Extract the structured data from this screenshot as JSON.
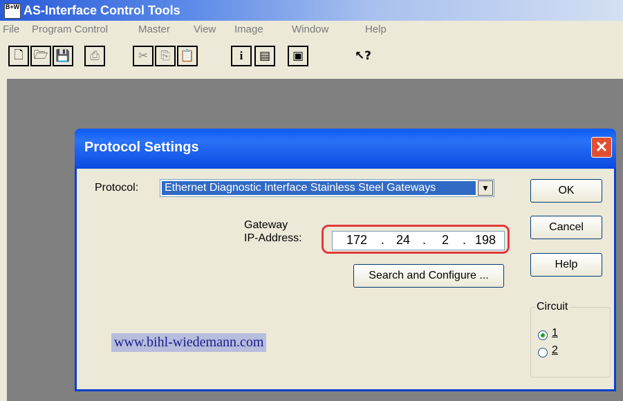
{
  "app": {
    "title": "AS-Interface Control Tools",
    "icon_text": "B+W"
  },
  "menu": [
    "File",
    "Program Control",
    "Master",
    "View",
    "Image",
    "Window",
    "Help"
  ],
  "toolbar": [
    {
      "icon": "new-document-icon",
      "glyph": "🗋",
      "disabled": false
    },
    {
      "icon": "open-folder-icon",
      "glyph": "🗁",
      "disabled": false
    },
    {
      "icon": "save-icon",
      "glyph": "💾",
      "disabled": true
    },
    {
      "icon": "print-icon",
      "glyph": "⎙",
      "disabled": true
    },
    {
      "icon": "cut-icon",
      "glyph": "✂",
      "disabled": true
    },
    {
      "icon": "copy-icon",
      "glyph": "⎘",
      "disabled": true
    },
    {
      "icon": "paste-icon",
      "glyph": "📋",
      "disabled": true
    },
    {
      "icon": "info-icon",
      "glyph": "i",
      "disabled": false
    },
    {
      "icon": "panel-icon",
      "glyph": "▤",
      "disabled": false
    },
    {
      "icon": "window-icon",
      "glyph": "▣",
      "disabled": false
    },
    {
      "icon": "context-help-icon",
      "glyph": "↖?",
      "disabled": false
    }
  ],
  "dialog": {
    "title": "Protocol Settings",
    "close_symbol": "✕",
    "protocol_label": "Protocol:",
    "protocol_value": "Ethernet Diagnostic Interface Stainless Steel Gateways",
    "dropdown_arrow": "▼",
    "gateway_label_line1": "Gateway",
    "gateway_label_line2": "IP-Address:",
    "ip": [
      "172",
      "24",
      "2",
      "198"
    ],
    "ip_dot": ".",
    "search_button": "Search and Configure ...",
    "ok_button": "OK",
    "cancel_button": "Cancel",
    "help_button": "Help",
    "circuit_label": "Circuit",
    "circuit_options": [
      "1",
      "2"
    ],
    "circuit_selected": "1",
    "url": "www.bihl-wiedemann.com"
  },
  "colors": {
    "highlight": "#e23a3a",
    "selection": "#316ac5",
    "titlebar": "#0a5af0"
  }
}
